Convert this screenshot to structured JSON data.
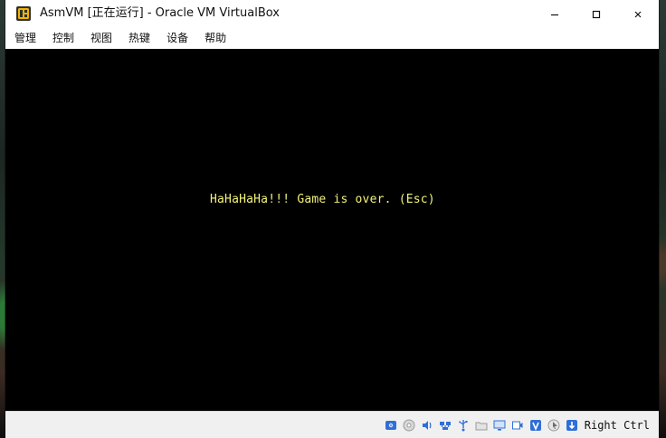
{
  "window": {
    "title": "AsmVM [正在运行] - Oracle VM VirtualBox",
    "app_icon": "virtualbox-icon",
    "controls": {
      "minimize_icon": "minimize-icon",
      "maximize_icon": "maximize-icon",
      "close_icon": "close-icon"
    }
  },
  "menubar": {
    "items": [
      "管理",
      "控制",
      "视图",
      "热键",
      "设备",
      "帮助"
    ]
  },
  "vm": {
    "message": "HaHaHaHa!!! Game is over. (Esc)",
    "message_color": "#f2f27a",
    "screen_color": "#000000"
  },
  "statusbar": {
    "icons": [
      "hard-disk-icon",
      "optical-drive-icon",
      "audio-icon",
      "network-icon",
      "usb-icon",
      "shared-folders-icon",
      "display-icon",
      "video-capture-icon",
      "virtualization-icon",
      "mouse-integration-icon",
      "keyboard-capture-icon"
    ],
    "host_key": "Right Ctrl"
  }
}
